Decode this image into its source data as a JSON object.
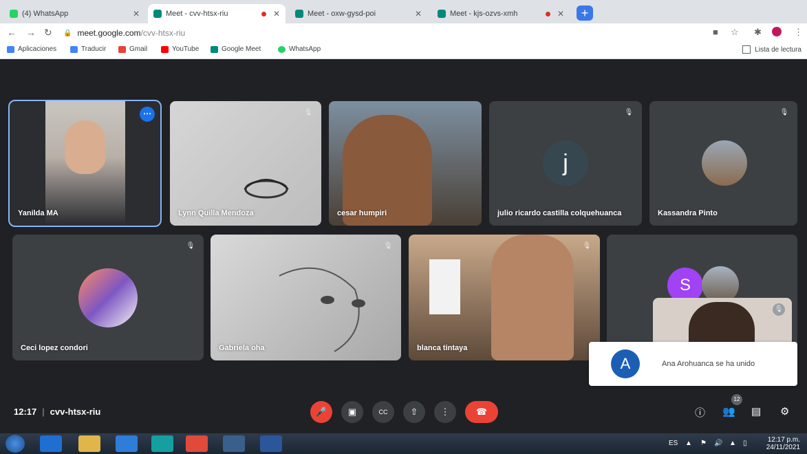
{
  "browser": {
    "tabs": [
      {
        "title": "(4) WhatsApp",
        "fav_color": "#25d366",
        "recording": false
      },
      {
        "title": "Meet - cvv-htsx-riu",
        "fav_color": "#00897b",
        "recording": true,
        "active": true
      },
      {
        "title": "Meet - oxw-gysd-poi",
        "fav_color": "#00897b",
        "recording": false
      },
      {
        "title": "Meet - kjs-ozvs-xmh",
        "fav_color": "#00897b",
        "recording": true
      }
    ],
    "newtab_label": "+",
    "address_host": "meet.google.com",
    "address_path": "/cvv-htsx-riu",
    "bookmarks": [
      {
        "label": "Aplicaciones",
        "color": "#4285f4"
      },
      {
        "label": "Traducir",
        "color": "#4285f4"
      },
      {
        "label": "Gmail",
        "color": "#ea4335"
      },
      {
        "label": "YouTube",
        "color": "#ff0000"
      },
      {
        "label": "Google Meet",
        "color": "#00897b"
      },
      {
        "label": "WhatsApp",
        "color": "#25d366"
      }
    ],
    "reading_list": "Lista de lectura"
  },
  "participants": [
    {
      "name": "Yanilda MA",
      "type": "video",
      "active": true
    },
    {
      "name": "Lynn Quilla Mendoza",
      "type": "video"
    },
    {
      "name": "cesar humpiri",
      "type": "video"
    },
    {
      "name": "julio ricardo castilla colquehuanca",
      "type": "avatar",
      "initial": "j",
      "avatar_color": "#37474f"
    },
    {
      "name": "Kassandra Pinto",
      "type": "photo"
    },
    {
      "name": "Ceci lopez condori",
      "type": "photo"
    },
    {
      "name": "Gabriela oha",
      "type": "video"
    },
    {
      "name": "blanca tintaya",
      "type": "video"
    },
    {
      "name": "",
      "type": "group",
      "initial": "S",
      "avatar_color": "#a142f4"
    }
  ],
  "toast": {
    "initial": "A",
    "message": "Ana Arohuanca se ha unido",
    "avatar_color": "#1a5fb4"
  },
  "meeting": {
    "time": "12:17",
    "separator": "|",
    "code": "cvv-htsx-riu",
    "participant_count": "12"
  },
  "controls": {
    "mic": "mic-off",
    "camera": "camera",
    "captions": "CC",
    "present": "present",
    "more": "more",
    "hangup": "hang-up"
  },
  "taskbar": {
    "lang": "ES",
    "time": "12:17 p.m.",
    "date": "24/11/2021"
  }
}
